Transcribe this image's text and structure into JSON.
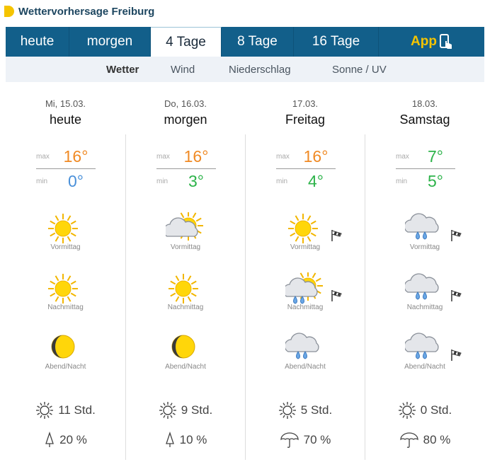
{
  "header": {
    "title": "Wettervorhersage Freiburg"
  },
  "tabs": [
    {
      "label": "heute"
    },
    {
      "label": "morgen"
    },
    {
      "label": "4 Tage",
      "active": true
    },
    {
      "label": "8 Tage"
    },
    {
      "label": "16 Tage"
    },
    {
      "label": "App"
    }
  ],
  "subtabs": [
    {
      "label": "Wetter",
      "active": true
    },
    {
      "label": "Wind"
    },
    {
      "label": "Niederschlag"
    },
    {
      "label": "Sonne / UV"
    }
  ],
  "labels": {
    "max": "max",
    "min": "min",
    "periods": [
      "Vormittag",
      "Nachmittag",
      "Abend/Nacht"
    ]
  },
  "colors": {
    "max": "#f08a24",
    "min_cold": "#4a90d9",
    "min_mild": "#2db34a",
    "tab_bg": "#125f8a",
    "accent": "#f5c400"
  },
  "days": [
    {
      "date": "Mi, 15.03.",
      "name": "heute",
      "max": "16°",
      "min": "0°",
      "max_color": "#f08a24",
      "min_color": "#4a90d9",
      "icons": [
        "sun",
        "sun",
        "moon"
      ],
      "wind": [
        false,
        false,
        false
      ],
      "sun": "11 Std.",
      "rain": "20 %",
      "rain_icon": "drop"
    },
    {
      "date": "Do, 16.03.",
      "name": "morgen",
      "max": "16°",
      "min": "3°",
      "max_color": "#f08a24",
      "min_color": "#2db34a",
      "icons": [
        "cloud-sun",
        "sun",
        "moon"
      ],
      "wind": [
        false,
        false,
        false
      ],
      "sun": "9 Std.",
      "rain": "10 %",
      "rain_icon": "drop"
    },
    {
      "date": "17.03.",
      "name": "Freitag",
      "max": "16°",
      "min": "4°",
      "max_color": "#f08a24",
      "min_color": "#2db34a",
      "icons": [
        "sun",
        "cloud-sun-rain",
        "cloud-rain"
      ],
      "wind": [
        true,
        true,
        false
      ],
      "sun": "5 Std.",
      "rain": "70 %",
      "rain_icon": "umbrella"
    },
    {
      "date": "18.03.",
      "name": "Samstag",
      "max": "7°",
      "min": "5°",
      "max_color": "#2db34a",
      "min_color": "#2db34a",
      "icons": [
        "cloud-rain",
        "cloud-rain",
        "cloud-rain"
      ],
      "wind": [
        true,
        true,
        true
      ],
      "sun": "0 Std.",
      "rain": "80 %",
      "rain_icon": "umbrella"
    }
  ]
}
